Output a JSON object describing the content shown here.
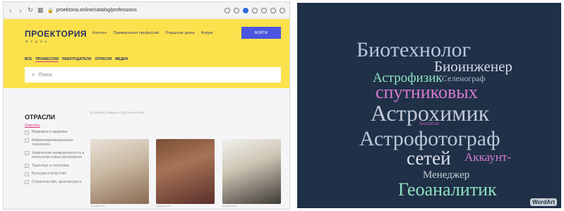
{
  "browser": {
    "url": "proektoria.online/catalog/professions",
    "site": {
      "logo": "ПРОЕКТОРИЯ",
      "logo_sub": "МЕДИА",
      "nav": [
        "Контент",
        "Примерочная профессий",
        "Открытые уроки",
        "Форум"
      ],
      "login": "ВОЙТИ",
      "tabs": [
        "ВСЕ",
        "ПРОФЕССИИ",
        "РАБОТОДАТЕЛИ",
        "ОТРАСЛИ",
        "МЕДИА"
      ],
      "active_tab": "ПРОФЕССИИ",
      "search_placeholder": "Поиск"
    },
    "filters": {
      "title": "ОТРАСЛИ",
      "clear": "Очистить",
      "items": [
        "Медицина и здоровье",
        "Инфокоммуникационные технологии",
        "Химическая промышленность и технологии новых материалов",
        "Транспорт и логистика",
        "Культура и искусство",
        "Строительство, архитектура и"
      ]
    },
    "found_text": "По запросу найдено 128 результатов",
    "card_caption": "профессия"
  },
  "wordcloud": {
    "words": [
      {
        "text": "Биотехнолог",
        "color": "#b9c6dd"
      },
      {
        "text": "Биоинженер",
        "color": "#d5dae5"
      },
      {
        "text": "Астрофизик",
        "color": "#8fe0c2"
      },
      {
        "text": "Селенограф",
        "color": "#aeb8c8"
      },
      {
        "text": "спутниковых",
        "color": "#d77ad0"
      },
      {
        "text": "Астрохимик",
        "color": "#c0c8d6"
      },
      {
        "text": "Аналитик",
        "color": "#c060b8"
      },
      {
        "text": "Астрофотограф",
        "color": "#b9c4d8"
      },
      {
        "text": "сетей",
        "color": "#dfe3ea"
      },
      {
        "text": "Аккаунт-",
        "color": "#d77ad0"
      },
      {
        "text": "Менеджер",
        "color": "#c8cdd6"
      },
      {
        "text": "Геоаналитик",
        "color": "#8fe0c2"
      }
    ],
    "badge": "WordArt"
  }
}
